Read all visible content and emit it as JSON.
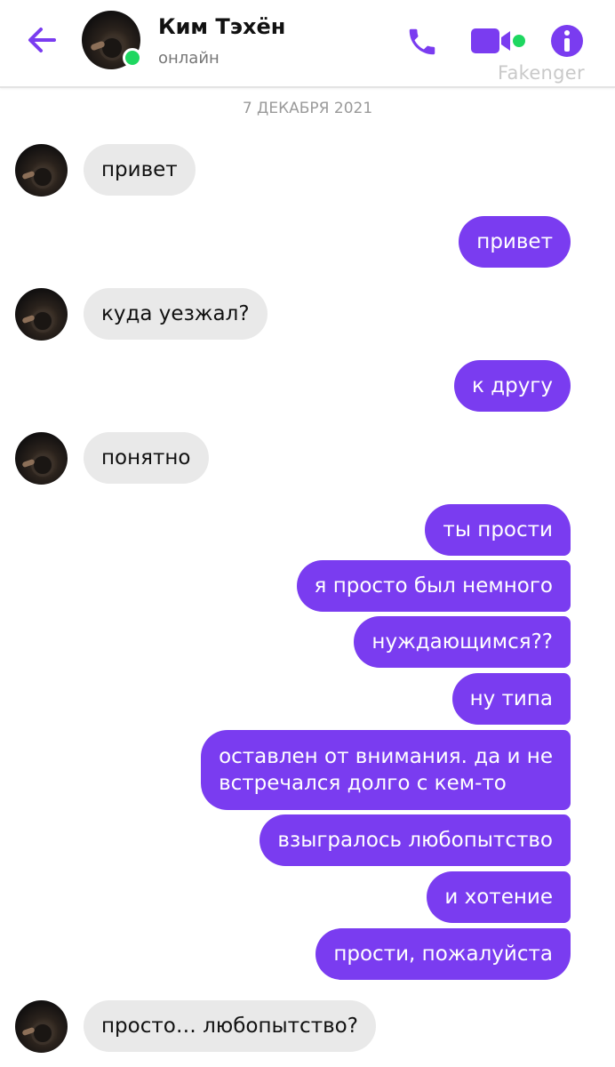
{
  "header": {
    "contact_name": "Ким Тэхён",
    "status": "онлайн",
    "watermark": "Fakenger",
    "accent_color": "#7a3cf0",
    "online_color": "#1ed760",
    "icons": [
      "arrow-left-icon",
      "phone-icon",
      "video-camera-icon",
      "info-icon"
    ]
  },
  "chat": {
    "date": "7 ДЕКАБРЯ 2021",
    "messages": [
      {
        "from": "them",
        "text": "привет"
      },
      {
        "from": "me",
        "text": "привет"
      },
      {
        "from": "them",
        "text": "куда уезжал?"
      },
      {
        "from": "me",
        "text": "к другу"
      },
      {
        "from": "them",
        "text": "понятно"
      },
      {
        "from": "me",
        "text": "ты прости"
      },
      {
        "from": "me",
        "text": "я просто был немного"
      },
      {
        "from": "me",
        "text": "нуждающимся??"
      },
      {
        "from": "me",
        "text": "ну типа"
      },
      {
        "from": "me",
        "text_line1": "оставлен от внимания. да и не",
        "text_line2": "встречался долго с кем-то"
      },
      {
        "from": "me",
        "text": "взыгралось любопытство"
      },
      {
        "from": "me",
        "text": "и хотение"
      },
      {
        "from": "me",
        "text": "прости, пожалуйста"
      },
      {
        "from": "them",
        "text": "просто… любопытство?"
      }
    ]
  }
}
